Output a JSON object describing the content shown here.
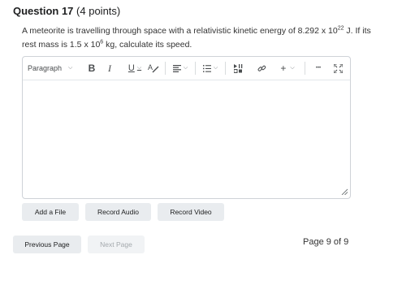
{
  "question": {
    "number_label": "Question 17",
    "points_label": "(4 points)",
    "text_part1": "A meteorite is travelling through space with a relativistic kinetic energy of 8.292 x 10",
    "exp1": "22",
    "text_part2": " J. If its rest mass is 1.5 x 10",
    "exp2": "6",
    "text_part3": " kg, calculate its speed."
  },
  "toolbar": {
    "paragraph_label": "Paragraph",
    "bold_label": "B",
    "italic_label": "I",
    "underline_label": "U",
    "font_color_label": "A",
    "more_label": "•••"
  },
  "icons": {
    "align": "align-left-icon",
    "list": "bulleted-list-icon",
    "media": "insert-media-icon",
    "link": "link-icon",
    "insert": "plus-icon",
    "more": "more-actions-icon",
    "fullscreen": "fullscreen-icon",
    "resize": "resize-handle-icon"
  },
  "buttons": {
    "add_file": "Add a File",
    "record_audio": "Record Audio",
    "record_video": "Record Video",
    "previous_page": "Previous Page",
    "next_page": "Next Page"
  },
  "pagination": {
    "label": "Page 9 of 9"
  }
}
